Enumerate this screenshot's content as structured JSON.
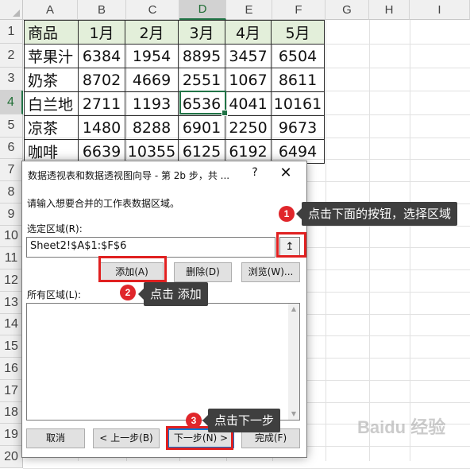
{
  "columns": [
    "A",
    "B",
    "C",
    "D",
    "E",
    "F",
    "G",
    "H",
    "I"
  ],
  "rows": [
    "1",
    "2",
    "3",
    "4",
    "5",
    "6",
    "7",
    "8",
    "9",
    "10",
    "11",
    "12",
    "13",
    "14",
    "15",
    "16",
    "17",
    "18",
    "19",
    "20"
  ],
  "table": {
    "header": [
      "商品",
      "1月",
      "2月",
      "3月",
      "4月",
      "5月"
    ],
    "rows": [
      [
        "苹果汁",
        "6384",
        "1954",
        "8895",
        "3457",
        "6504"
      ],
      [
        "奶茶",
        "8702",
        "4669",
        "2551",
        "1067",
        "8611"
      ],
      [
        "白兰地",
        "2711",
        "1193",
        "6536",
        "4041",
        "10161"
      ],
      [
        "凉茶",
        "1480",
        "8288",
        "6901",
        "2250",
        "9673"
      ],
      [
        "咖啡",
        "6639",
        "10355",
        "6125",
        "6192",
        "6494"
      ]
    ]
  },
  "dialog": {
    "title": "数据透视表和数据透视图向导 - 第 2b 步，共 ...",
    "help": "?",
    "close": "✕",
    "instruction": "请输入想要合并的工作表数据区域。",
    "range_label": "选定区域(R):",
    "range_value": "Sheet2!$A$1:$F$6",
    "collapse_icon": "↥",
    "add": "添加(A)",
    "delete": "删除(D)",
    "browse": "浏览(W)...",
    "all_ranges_label": "所有区域(L):",
    "cancel": "取消",
    "prev": "< 上一步(B)",
    "next": "下一步(N) >",
    "finish": "完成(F)"
  },
  "annotations": [
    {
      "badge": "1",
      "text": "点击下面的按钮，选择区域"
    },
    {
      "badge": "2",
      "text": "点击 添加"
    },
    {
      "badge": "3",
      "text": "点击下一步"
    }
  ],
  "watermark": "Baidu 经验"
}
